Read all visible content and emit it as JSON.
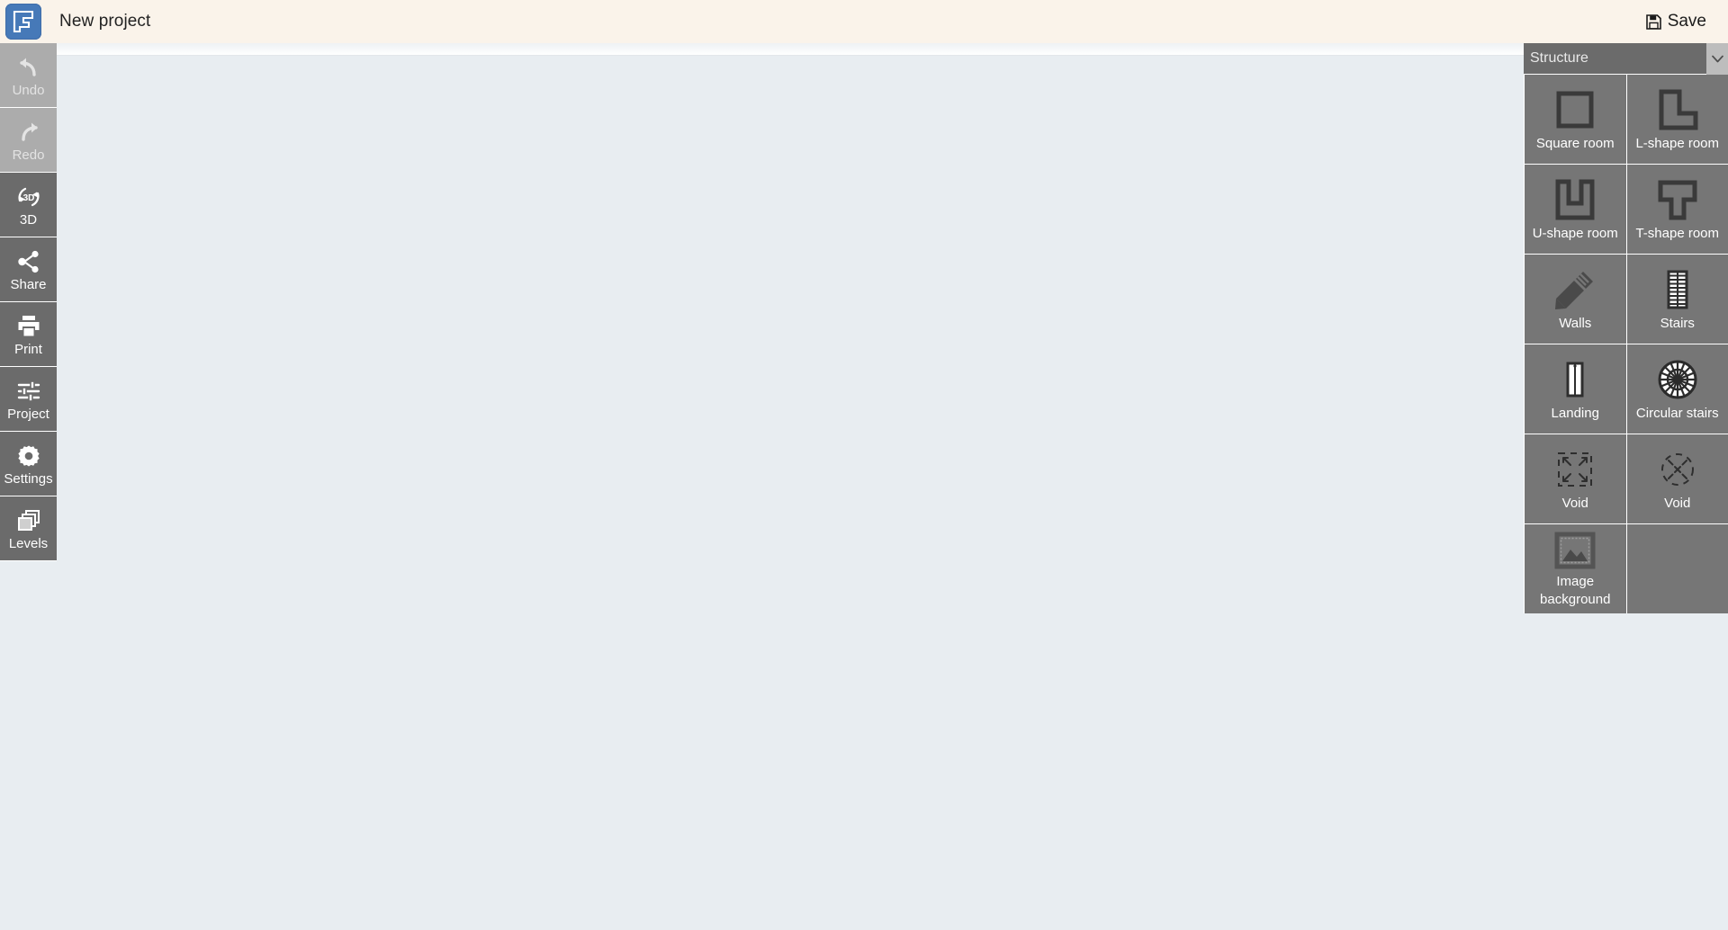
{
  "header": {
    "logo_icon": "floorplan-logo-icon",
    "project_title": "New project",
    "save_label": "Save",
    "save_icon": "floppy-disk-icon",
    "background_color": "#faf3ea"
  },
  "canvas": {
    "background_color": "#e8edf1",
    "scrollbar_orientation": "horizontal"
  },
  "toolbar": {
    "items": [
      {
        "label": "Undo",
        "icon": "undo-arrow-icon",
        "disabled": true
      },
      {
        "label": "Redo",
        "icon": "redo-arrow-icon",
        "disabled": true
      },
      {
        "label": "3D",
        "icon": "rotate-3d-icon",
        "disabled": false
      },
      {
        "label": "Share",
        "icon": "share-nodes-icon",
        "disabled": false
      },
      {
        "label": "Print",
        "icon": "printer-icon",
        "disabled": false
      },
      {
        "label": "Project",
        "icon": "sliders-icon",
        "disabled": false
      },
      {
        "label": "Settings",
        "icon": "gear-icon",
        "disabled": false
      },
      {
        "label": "Levels",
        "icon": "layers-icon",
        "disabled": false
      }
    ]
  },
  "right_panel": {
    "title": "Structure",
    "chevron_icon": "chevron-down-icon",
    "tiles": [
      {
        "label": "Square room",
        "icon": "square-room-icon"
      },
      {
        "label": "L-shape room",
        "icon": "l-shape-room-icon"
      },
      {
        "label": "U-shape room",
        "icon": "u-shape-room-icon"
      },
      {
        "label": "T-shape room",
        "icon": "t-shape-room-icon"
      },
      {
        "label": "Walls",
        "icon": "pencil-icon"
      },
      {
        "label": "Stairs",
        "icon": "stairs-icon"
      },
      {
        "label": "Landing",
        "icon": "landing-icon"
      },
      {
        "label": "Circular stairs",
        "icon": "circular-stairs-icon"
      },
      {
        "label": "Void",
        "icon": "void-square-icon"
      },
      {
        "label": "Void",
        "icon": "void-circle-icon"
      },
      {
        "label": "Image background",
        "icon": "image-frame-icon"
      },
      {
        "label": "",
        "icon": ""
      }
    ]
  },
  "colors": {
    "header_bg": "#faf3ea",
    "toolbar_bg": "#6b6b6b",
    "toolbar_disabled_bg": "#acacac",
    "panel_tile_bg": "#767676",
    "canvas_bg": "#e8edf1",
    "logo_blue": "#4679b8"
  }
}
